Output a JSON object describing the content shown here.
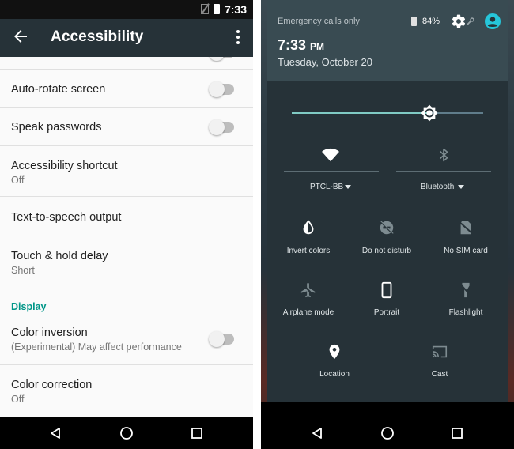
{
  "left": {
    "status_time": "7:33",
    "app_title": "Accessibility",
    "rows": [
      {
        "title": "Auto-rotate screen"
      },
      {
        "title": "Speak passwords"
      },
      {
        "title": "Accessibility shortcut",
        "subtitle": "Off"
      },
      {
        "title": "Text-to-speech output"
      },
      {
        "title": "Touch & hold delay",
        "subtitle": "Short"
      },
      {
        "title": "Color inversion",
        "subtitle": "(Experimental) May affect performance"
      },
      {
        "title": "Color correction",
        "subtitle": "Off"
      }
    ],
    "section_display": "Display"
  },
  "right": {
    "emergency": "Emergency calls only",
    "battery_pct": "84%",
    "time": "7:33",
    "ampm": "PM",
    "date": "Tuesday, October 20",
    "brightness_level": 0.72,
    "wifi_label": "PTCL-BB",
    "bluetooth_label": "Bluetooth",
    "tiles": [
      {
        "label": "Invert colors",
        "icon": "invert-colors-icon"
      },
      {
        "label": "Do not disturb",
        "icon": "do-not-disturb-icon"
      },
      {
        "label": "No SIM card",
        "icon": "no-sim-icon"
      },
      {
        "label": "Airplane mode",
        "icon": "airplane-icon"
      },
      {
        "label": "Portrait",
        "icon": "portrait-icon"
      },
      {
        "label": "Flashlight",
        "icon": "flashlight-icon"
      },
      {
        "label": "Location",
        "icon": "location-icon"
      },
      {
        "label": "Cast",
        "icon": "cast-icon"
      }
    ]
  },
  "colors": {
    "appbar": "#263238",
    "accent": "#009688",
    "user_icon": "#26c6da"
  }
}
